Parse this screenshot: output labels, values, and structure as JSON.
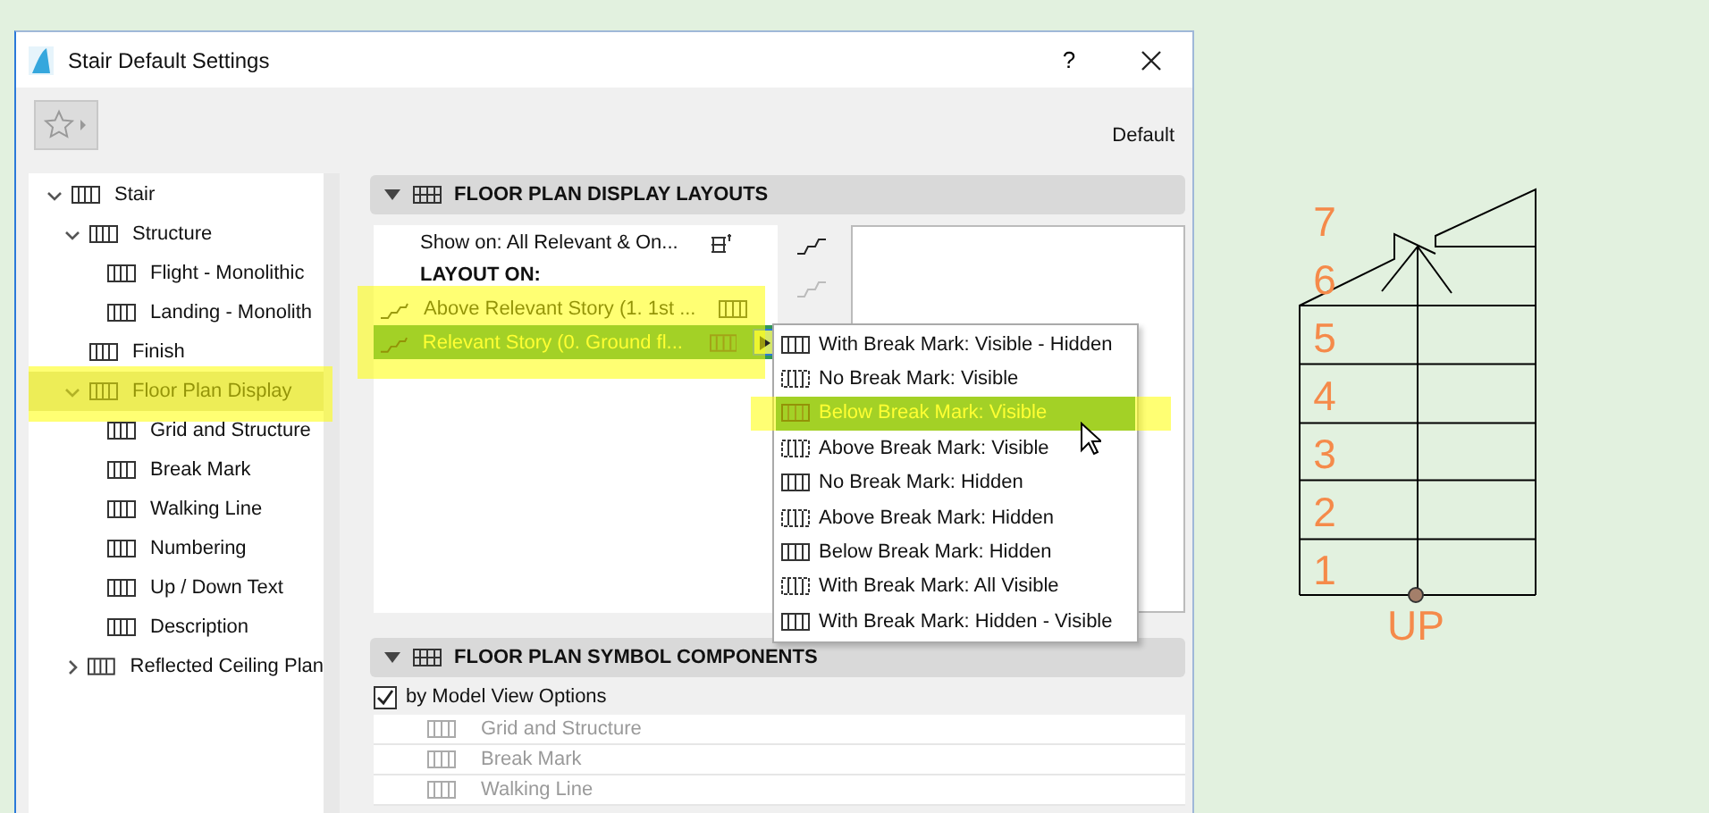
{
  "window": {
    "title": "Stair Default Settings",
    "help": "?"
  },
  "toolbar": {
    "preset": "Default"
  },
  "tree": [
    {
      "label": "Stair",
      "expanded": true,
      "selected": false,
      "children": [
        {
          "label": "Structure",
          "expanded": true,
          "selected": false,
          "children": [
            {
              "label": "Flight - Monolithic",
              "selected": false
            },
            {
              "label": "Landing - Monolith",
              "selected": false
            }
          ]
        },
        {
          "label": "Finish",
          "selected": false
        },
        {
          "label": "Floor Plan Display",
          "expanded": true,
          "selected": true,
          "children": [
            {
              "label": "Grid and Structure",
              "selected": false
            },
            {
              "label": "Break Mark",
              "selected": false
            },
            {
              "label": "Walking Line",
              "selected": false
            },
            {
              "label": "Numbering",
              "selected": false
            },
            {
              "label": "Up / Down Text",
              "selected": false
            },
            {
              "label": "Description",
              "selected": false
            }
          ]
        },
        {
          "label": "Reflected Ceiling Plan",
          "expanded": false,
          "selected": false
        }
      ]
    }
  ],
  "layouts_section": {
    "title": "FLOOR PLAN DISPLAY LAYOUTS",
    "expanded": true,
    "show_on": "Show on: All Relevant & On...",
    "layout_on": "LAYOUT ON:",
    "layouts": [
      {
        "label": "Above Relevant Story (1. 1st ...",
        "selected": false
      },
      {
        "label": "Relevant Story (0. Ground fl...",
        "selected": true
      }
    ]
  },
  "menu": {
    "items": [
      {
        "label": "With Break Mark: Visible - Hidden",
        "selected": false
      },
      {
        "label": "No Break Mark: Visible",
        "selected": false
      },
      {
        "label": "Below Break Mark: Visible",
        "selected": true
      },
      {
        "label": "Above Break Mark: Visible",
        "selected": false
      },
      {
        "label": "No Break Mark: Hidden",
        "selected": false
      },
      {
        "label": "Above Break Mark: Hidden",
        "selected": false
      },
      {
        "label": "Below Break Mark: Hidden",
        "selected": false
      },
      {
        "label": "With Break Mark: All Visible",
        "selected": false
      },
      {
        "label": "With Break Mark: Hidden - Visible",
        "selected": false
      }
    ]
  },
  "symbol_section": {
    "title": "FLOOR PLAN SYMBOL COMPONENTS",
    "expanded": true,
    "by_model_view": {
      "label": "by Model View Options",
      "checked": true
    },
    "components": [
      {
        "label": "Grid and Structure",
        "disabled": true
      },
      {
        "label": "Break Mark",
        "disabled": true
      },
      {
        "label": "Walking Line",
        "disabled": true
      }
    ]
  },
  "plan": {
    "numbers": [
      "7",
      "6",
      "5",
      "4",
      "3",
      "2",
      "1"
    ],
    "direction": "UP"
  }
}
